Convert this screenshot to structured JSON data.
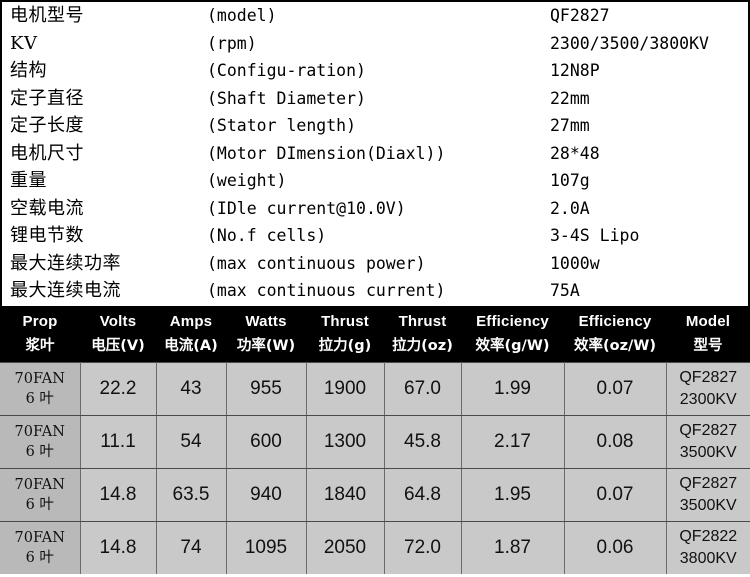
{
  "spec": {
    "rows": [
      {
        "cn": "电机型号",
        "en": "(model)",
        "value": "QF2827"
      },
      {
        "cn": "KV",
        "en": "(rpm)",
        "value": "2300/3500/3800KV"
      },
      {
        "cn": "结构",
        "en": "(Configu-ration)",
        "value": "12N8P"
      },
      {
        "cn": "定子直径",
        "en": "(Shaft Diameter)",
        "value": "22mm"
      },
      {
        "cn": "定子长度",
        "en": "(Stator length)",
        "value": "27mm"
      },
      {
        "cn": "电机尺寸",
        "en": "(Motor DImension(Diaxl))",
        "value": "28*48"
      },
      {
        "cn": "重量",
        "en": "(weight)",
        "value": "107g"
      },
      {
        "cn": "空载电流",
        "en": "(IDle current@10.0V)",
        "value": "2.0A"
      },
      {
        "cn": "锂电节数",
        "en": "(No.f cells)",
        "value": "3-4S Lipo"
      },
      {
        "cn": "最大连续功率",
        "en": "(max continuous power)",
        "value": "1000w"
      },
      {
        "cn": "最大连续电流",
        "en": "(max continuous current)",
        "value": "75A"
      }
    ]
  },
  "table": {
    "columns": [
      {
        "en": "Prop",
        "cn": "浆叶"
      },
      {
        "en": "Volts",
        "cn": "电压(V)"
      },
      {
        "en": "Amps",
        "cn": "电流(A)"
      },
      {
        "en": "Watts",
        "cn": "功率(W)"
      },
      {
        "en": "Thrust",
        "cn": "拉力(g)"
      },
      {
        "en": "Thrust",
        "cn": "拉力(oz)"
      },
      {
        "en": "Efficiency",
        "cn": "效率(g/W)"
      },
      {
        "en": "Efficiency",
        "cn": "效率(oz/W)"
      },
      {
        "en": "Model",
        "cn": "型号"
      }
    ],
    "rows": [
      {
        "prop_l1": "70FAN",
        "prop_l2": "6 叶",
        "volts": "22.2",
        "amps": "43",
        "watts": "955",
        "thrust_g": "1900",
        "thrust_oz": "67.0",
        "eff_gw": "1.99",
        "eff_ozw": "0.07",
        "model_l1": "QF2827",
        "model_l2": "2300KV"
      },
      {
        "prop_l1": "70FAN",
        "prop_l2": "6 叶",
        "volts": "11.1",
        "amps": "54",
        "watts": "600",
        "thrust_g": "1300",
        "thrust_oz": "45.8",
        "eff_gw": "2.17",
        "eff_ozw": "0.08",
        "model_l1": "QF2827",
        "model_l2": "3500KV"
      },
      {
        "prop_l1": "70FAN",
        "prop_l2": "6 叶",
        "volts": "14.8",
        "amps": "63.5",
        "watts": "940",
        "thrust_g": "1840",
        "thrust_oz": "64.8",
        "eff_gw": "1.95",
        "eff_ozw": "0.07",
        "model_l1": "QF2827",
        "model_l2": "3500KV"
      },
      {
        "prop_l1": "70FAN",
        "prop_l2": "6 叶",
        "volts": "14.8",
        "amps": "74",
        "watts": "1095",
        "thrust_g": "2050",
        "thrust_oz": "72.0",
        "eff_gw": "1.87",
        "eff_ozw": "0.06",
        "model_l1": "QF2822",
        "model_l2": "3800KV"
      }
    ]
  },
  "colors": {
    "header_bg": "#000000",
    "header_fg": "#ffffff",
    "cell_bg": "#c9c9c9",
    "prop_cell_bg": "#b9b9b9",
    "grid": "#4a4a4a",
    "page_bg": "#ffffff"
  }
}
